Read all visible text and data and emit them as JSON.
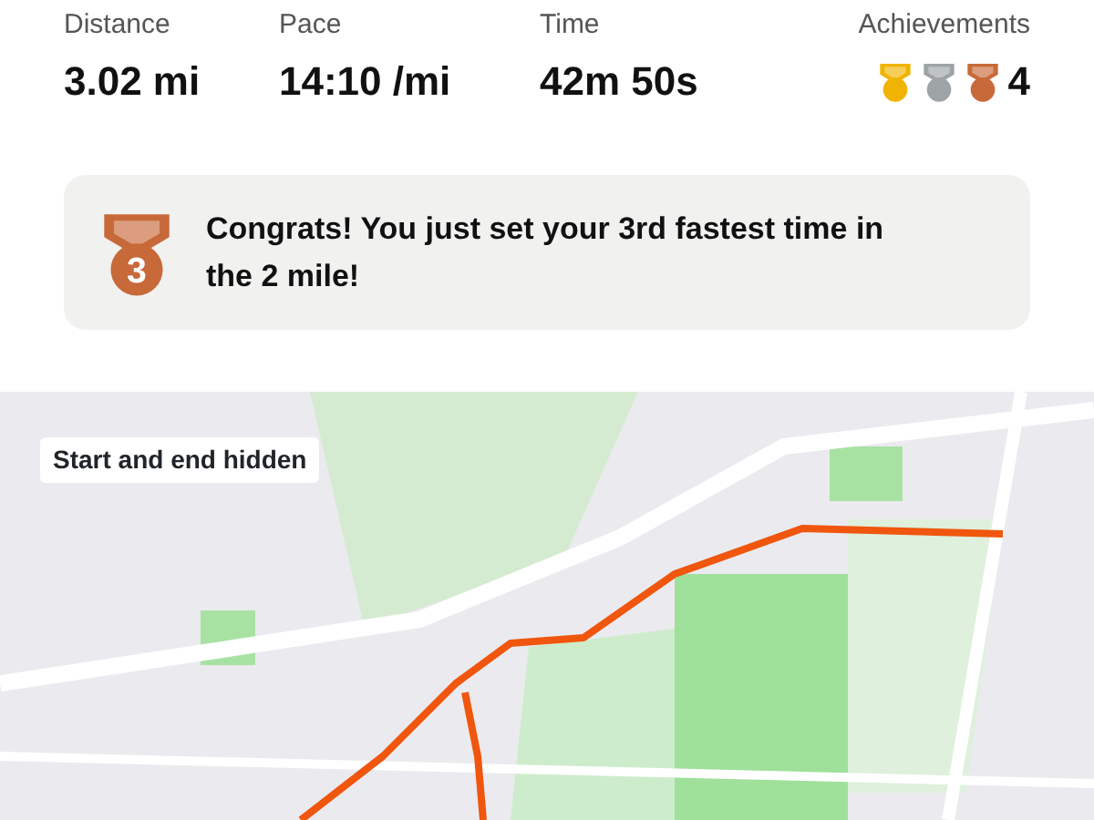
{
  "stats": [
    {
      "label": "Distance",
      "value": "3.02 mi"
    },
    {
      "label": "Pace",
      "value": "14:10 /mi"
    },
    {
      "label": "Time",
      "value": "42m 50s"
    }
  ],
  "achievements": {
    "label": "Achievements",
    "count": "4",
    "medals": [
      {
        "color": "#f0b400"
      },
      {
        "color": "#9ea3a6"
      },
      {
        "color": "#c8693a"
      }
    ]
  },
  "banner": {
    "medal_rank": "3",
    "message": "Congrats! You just set your 3rd fastest time in the 2 mile!"
  },
  "map": {
    "kind": "picture",
    "notice": "Start and end hidden"
  }
}
